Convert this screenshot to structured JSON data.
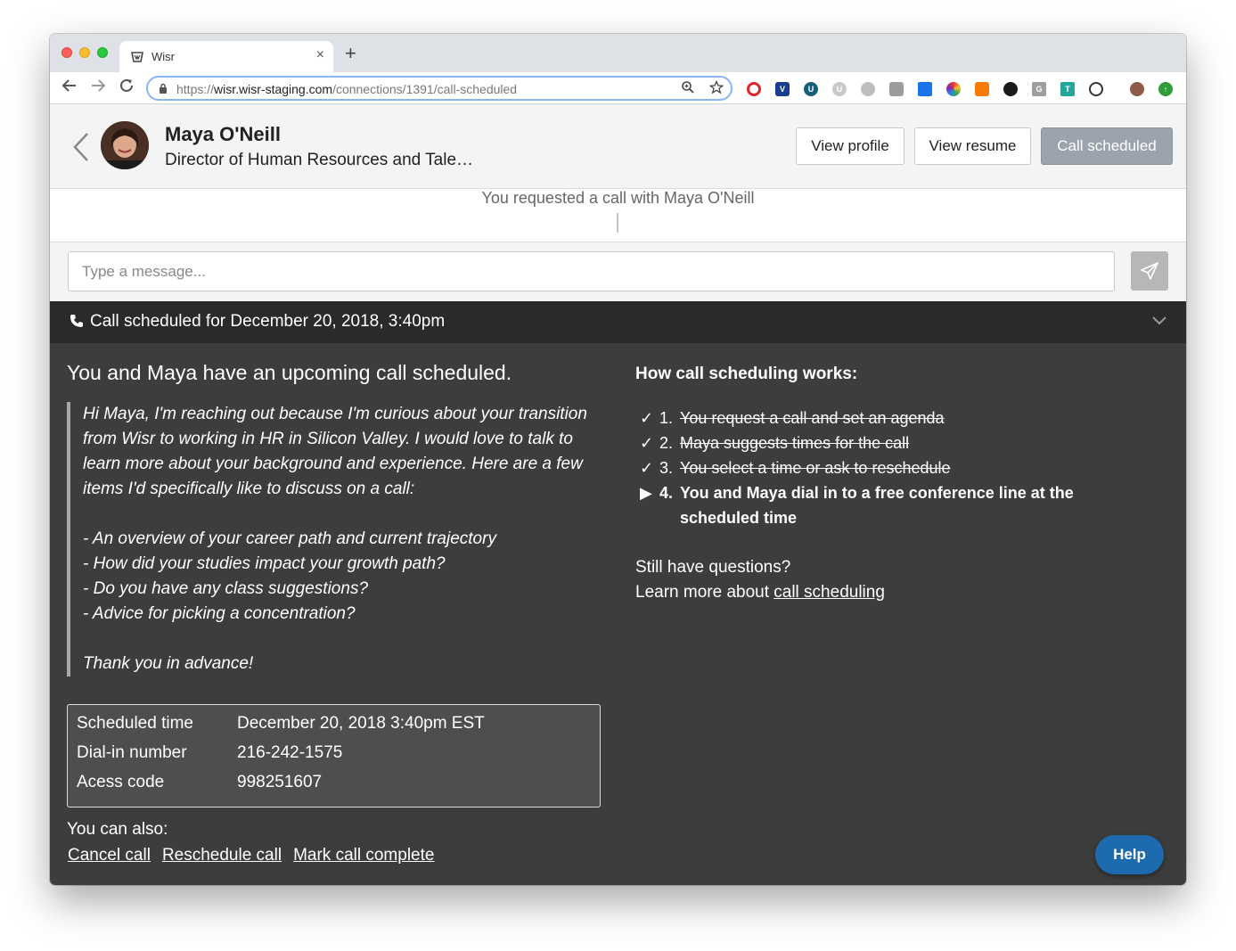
{
  "browser": {
    "tab_title": "Wisr",
    "new_tab_label": "+",
    "close_tab_label": "×",
    "url_prefix": "https://",
    "url_host": "wisr.wisr-staging.com",
    "url_path": "/connections/1391/call-scheduled"
  },
  "profile": {
    "name": "Maya O'Neill",
    "title": "Director of Human Resources and Tale…",
    "view_profile_label": "View profile",
    "view_resume_label": "View resume",
    "call_scheduled_label": "Call scheduled"
  },
  "messages": {
    "requested_text": "You requested a call with Maya O'Neill"
  },
  "composer": {
    "placeholder": "Type a message..."
  },
  "call_bar": {
    "text": "Call scheduled for December 20, 2018, 3:40pm"
  },
  "panel": {
    "heading": "You and Maya have an upcoming call scheduled.",
    "message": "Hi Maya, I'm reaching out because I'm curious about your transition from Wisr to working in HR in Silicon Valley. I would love to talk to learn more about your background and experience. Here are a few items I'd specifically like to discuss on a call:\n\n- An overview of your career path and current trajectory\n- How did your studies impact your growth path?\n- Do you have any class suggestions?\n- Advice for picking a concentration?\n\nThank you in advance!",
    "details": [
      {
        "label": "Scheduled time",
        "value": "December 20, 2018 3:40pm EST"
      },
      {
        "label": "Dial-in number",
        "value": "216-242-1575"
      },
      {
        "label": "Acess code",
        "value": "998251607"
      }
    ],
    "also_label": "You can also:",
    "links": {
      "cancel": "Cancel call",
      "reschedule": "Reschedule call",
      "complete": "Mark call complete"
    },
    "how_title": "How call scheduling works:",
    "steps": [
      {
        "marker": "✓",
        "number": "1.",
        "text": "You request a call and set an agenda"
      },
      {
        "marker": "✓",
        "number": "2.",
        "text": "Maya suggests times for the call"
      },
      {
        "marker": "✓",
        "number": "3.",
        "text": "You select a time or ask to reschedule"
      },
      {
        "marker": "▶",
        "number": "4.",
        "text": "You and Maya dial in to a free conference line at the scheduled time"
      }
    ],
    "still_questions": "Still have questions?",
    "learn_more_prefix": "Learn more about ",
    "learn_more_link": "call scheduling",
    "help_label": "Help"
  },
  "colors": {
    "panel_bg": "#3d3d3d",
    "call_bar_bg": "#2a2a2a",
    "help_button": "#1d6aaf",
    "primary_button": "#9ba4ac"
  },
  "icons": [
    "wisr-favicon",
    "lock-icon",
    "zoom-icon",
    "star-icon",
    "back-icon",
    "forward-icon",
    "reload-icon",
    "chevron-left-icon",
    "phone-icon",
    "send-icon",
    "chevron-down-icon"
  ]
}
